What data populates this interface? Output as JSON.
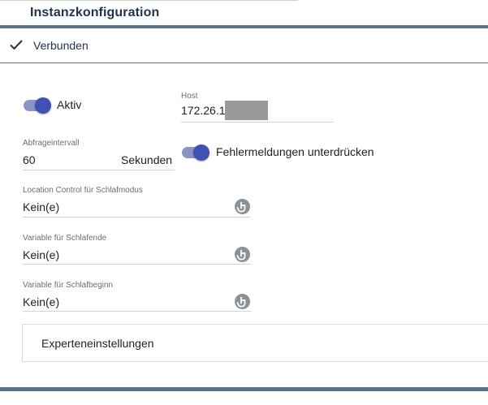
{
  "header": {
    "title": "Instanzkonfiguration"
  },
  "status": {
    "label": "Verbunden",
    "icon": "check-icon"
  },
  "active_toggle": {
    "label": "Aktiv",
    "on": true
  },
  "host": {
    "label": "Host",
    "value": "172.26.1"
  },
  "interval": {
    "label": "Abfrageintervall",
    "value": "60",
    "unit": "Sekunden"
  },
  "suppress_errors_toggle": {
    "label": "Fehlermeldungen unterdrücken",
    "on": true
  },
  "location_control": {
    "label": "Location Control für Schlafmodus",
    "value": "Kein(e)"
  },
  "sleep_end_variable": {
    "label": "Variable für Schlafende",
    "value": "Kein(e)"
  },
  "sleep_begin_variable": {
    "label": "Variable für Schlafbeginn",
    "value": "Kein(e)"
  },
  "expert_settings": {
    "label": "Experteneinstellungen"
  },
  "colors": {
    "accent": "#3f51b5",
    "accent_track": "#8c93c9",
    "header_bar": "#5f7186",
    "title": "#24324a"
  }
}
